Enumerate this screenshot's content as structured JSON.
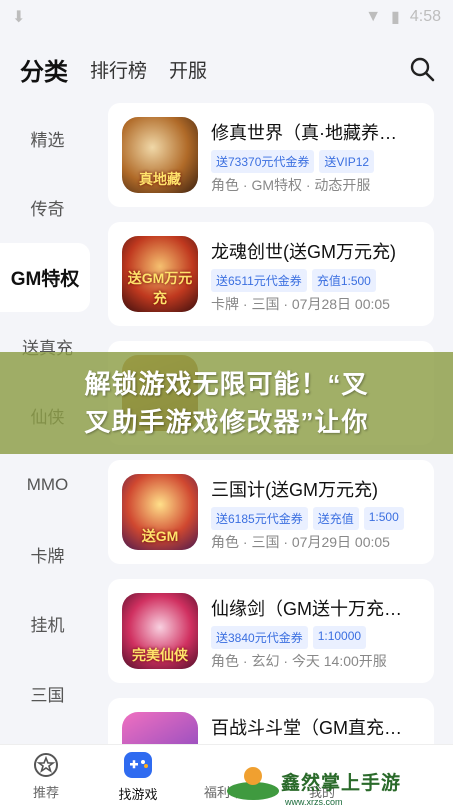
{
  "status": {
    "time": "4:58"
  },
  "nav": {
    "tabs": [
      "分类",
      "排行榜",
      "开服"
    ]
  },
  "sidebar": {
    "items": [
      "精选",
      "传奇",
      "GM特权",
      "送真充",
      "仙侠",
      "MMO",
      "卡牌",
      "挂机",
      "三国"
    ],
    "active_index": 2
  },
  "games": [
    {
      "title": "修真世界（真·地藏养…",
      "tags": [
        "送73370元代金券",
        "送VIP12"
      ],
      "meta": "角色 · GM特权 · 动态开服",
      "thumb_label": "真地藏"
    },
    {
      "title": "龙魂创世(送GM万元充)",
      "tags": [
        "送6511元代金券",
        "充值1:500"
      ],
      "meta": "卡牌 · 三国 · 07月28日 00:05",
      "thumb_label": "送GM万元充"
    },
    {
      "title": "三国计(送GM万元充)",
      "tags": [
        "送6185元代金券",
        "送充值",
        "1:500"
      ],
      "meta": "角色 · 三国 · 07月29日 00:05",
      "thumb_label": "送GM"
    },
    {
      "title": "仙缘剑（GM送十万充…",
      "tags": [
        "送3840元代金券",
        "1:10000"
      ],
      "meta": "角色 · 玄幻 · 今天 14:00开服",
      "thumb_label": "完美仙侠"
    },
    {
      "title": "百战斗斗堂（GM直充…",
      "tags": [],
      "meta": "",
      "thumb_label": ""
    }
  ],
  "banner": {
    "line1": "解锁游戏无限可能！“叉",
    "line2": "叉助手游戏修改器”让你"
  },
  "bottom": {
    "items": [
      "推荐",
      "找游戏",
      "福利中心",
      "我的"
    ]
  },
  "watermark": {
    "text": "鑫然掌上手游",
    "url": "www.xrzs.com"
  },
  "colors": {
    "accent": "#3b6fe0",
    "banner": "#8c9e46"
  },
  "icons": [
    "search-icon",
    "download-icon",
    "wifi-icon",
    "battery-icon",
    "star-icon",
    "gamepad-icon"
  ]
}
